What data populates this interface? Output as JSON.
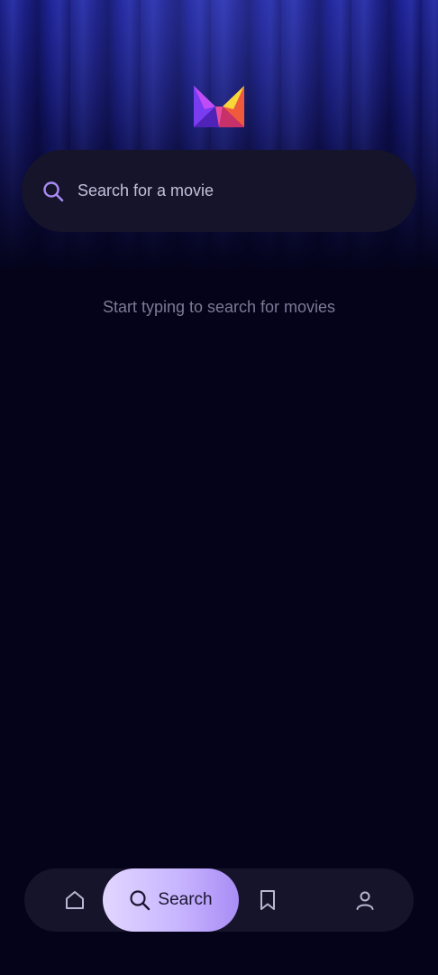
{
  "app": {
    "logo_icon": "movie-app-logo"
  },
  "search": {
    "placeholder": "Search for a movie",
    "icon": "search-icon",
    "accent_color": "#a98cf5"
  },
  "empty_state": {
    "message": "Start typing to search for movies"
  },
  "tabbar": {
    "tabs": [
      {
        "id": "home",
        "icon": "home-icon",
        "label": "",
        "active": false
      },
      {
        "id": "search",
        "icon": "search-icon",
        "label": "Search",
        "active": true
      },
      {
        "id": "saved",
        "icon": "bookmark-icon",
        "label": "",
        "active": false
      },
      {
        "id": "profile",
        "icon": "profile-icon",
        "label": "",
        "active": false
      }
    ],
    "active_gradient": [
      "#e2d6ff",
      "#a98cf5"
    ]
  }
}
